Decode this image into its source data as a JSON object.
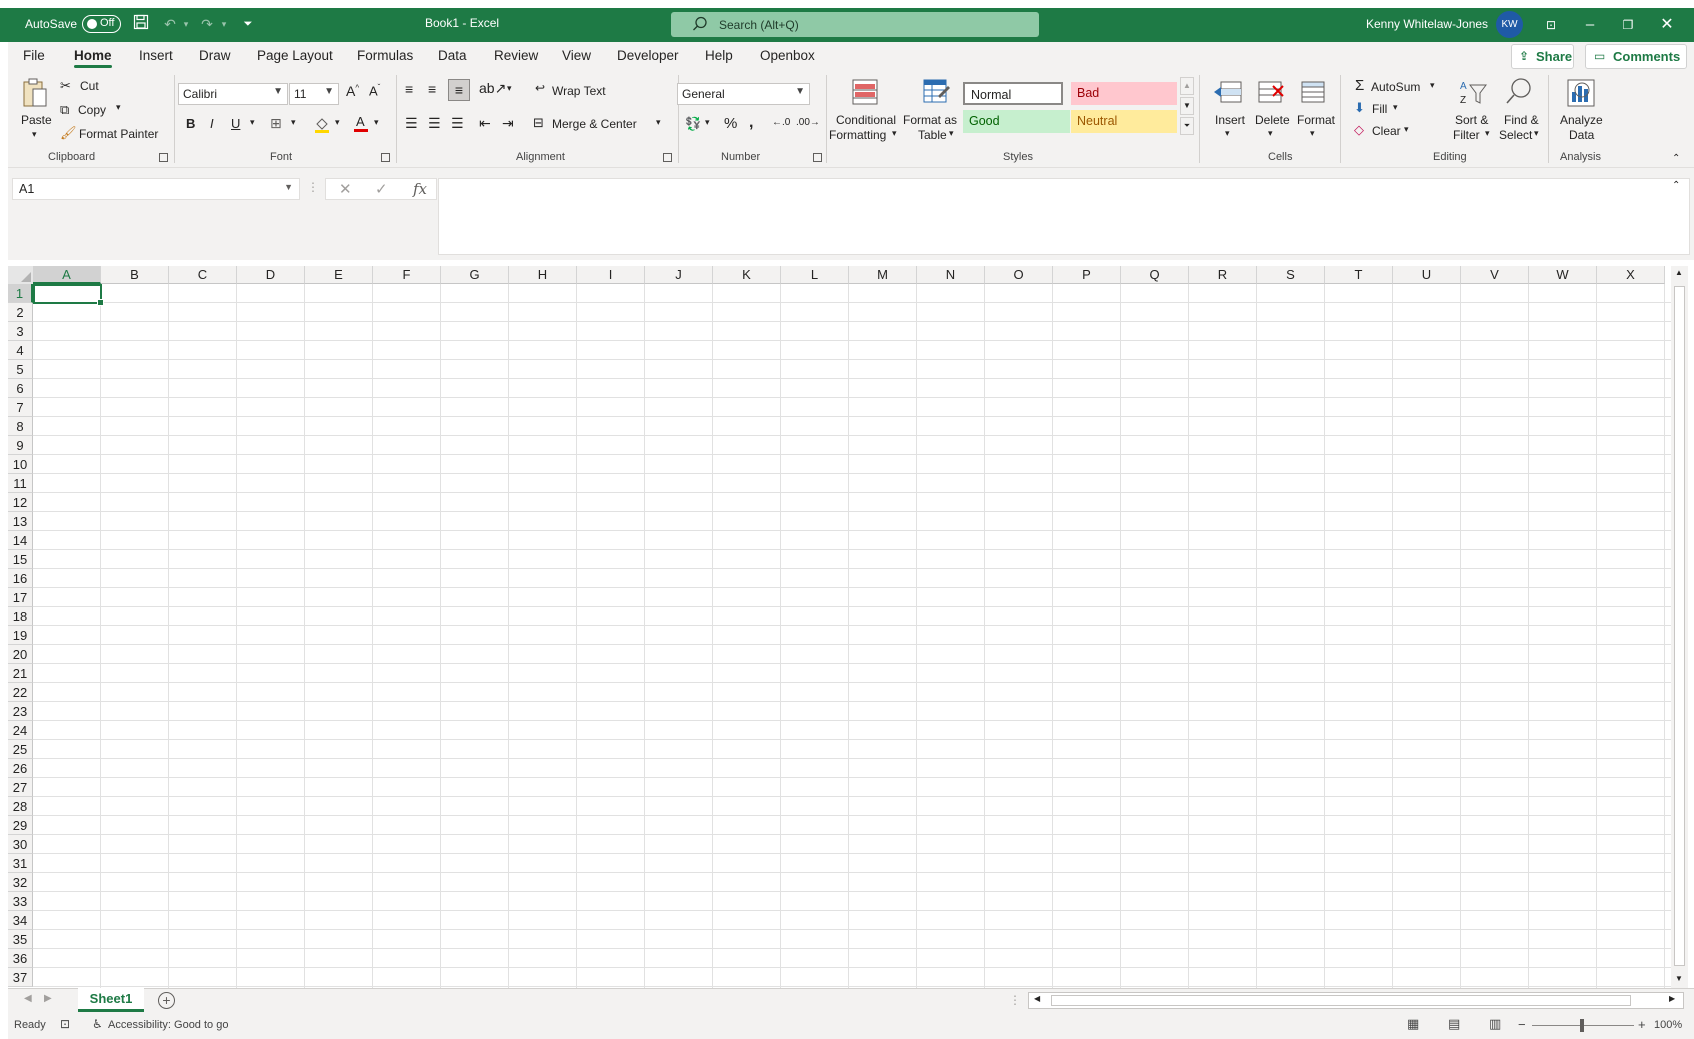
{
  "titlebar": {
    "autosave_label": "AutoSave",
    "autosave_state": "Off",
    "document_title": "Book1  -  Excel",
    "search_placeholder": "Search (Alt+Q)",
    "user_name": "Kenny Whitelaw-Jones",
    "user_initials": "KW",
    "accent_color": "#1e7a45"
  },
  "tabs": [
    "File",
    "Home",
    "Insert",
    "Draw",
    "Page Layout",
    "Formulas",
    "Data",
    "Review",
    "View",
    "Developer",
    "Help",
    "Openbox"
  ],
  "active_tab": "Home",
  "share_label": "Share",
  "comments_label": "Comments",
  "ribbon": {
    "clipboard": {
      "paste": "Paste",
      "cut": "Cut",
      "copy": "Copy",
      "format_painter": "Format Painter",
      "group": "Clipboard"
    },
    "font": {
      "font_name": "Calibri",
      "font_size": "11",
      "bold": "B",
      "italic": "I",
      "underline": "U",
      "group": "Font"
    },
    "alignment": {
      "wrap_text": "Wrap Text",
      "merge_center": "Merge & Center",
      "group": "Alignment"
    },
    "number": {
      "format": "General",
      "group": "Number"
    },
    "styles": {
      "conditional_formatting": [
        "Conditional",
        "Formatting"
      ],
      "format_as_table": [
        "Format as",
        "Table"
      ],
      "normal": "Normal",
      "bad": "Bad",
      "good": "Good",
      "neutral": "Neutral",
      "group": "Styles"
    },
    "cells": {
      "insert": "Insert",
      "delete": "Delete",
      "format": "Format",
      "group": "Cells"
    },
    "editing": {
      "autosum": "AutoSum",
      "fill": "Fill",
      "clear": "Clear",
      "sort_filter": [
        "Sort &",
        "Filter"
      ],
      "find_select": [
        "Find &",
        "Select"
      ],
      "group": "Editing"
    },
    "analysis": {
      "analyze_data": [
        "Analyze",
        "Data"
      ],
      "group": "Analysis"
    }
  },
  "formula_bar": {
    "name_box": "A1",
    "fx": "fx"
  },
  "grid": {
    "columns": [
      "A",
      "B",
      "C",
      "D",
      "E",
      "F",
      "G",
      "H",
      "I",
      "J",
      "K",
      "L",
      "M",
      "N",
      "O",
      "P",
      "Q",
      "R",
      "S",
      "T",
      "U",
      "V",
      "W",
      "X"
    ],
    "rows": [
      "1",
      "2",
      "3",
      "4",
      "5",
      "6",
      "7",
      "8",
      "9",
      "10",
      "11",
      "12",
      "13",
      "14",
      "15",
      "16",
      "17",
      "18",
      "19",
      "20",
      "21",
      "22",
      "23",
      "24",
      "25",
      "26",
      "27",
      "28",
      "29",
      "30",
      "31",
      "32",
      "33",
      "34",
      "35",
      "36",
      "37"
    ],
    "active_cell": "A1"
  },
  "sheets": [
    "Sheet1"
  ],
  "statusbar": {
    "ready": "Ready",
    "accessibility": "Accessibility: Good to go",
    "zoom": "100%"
  }
}
